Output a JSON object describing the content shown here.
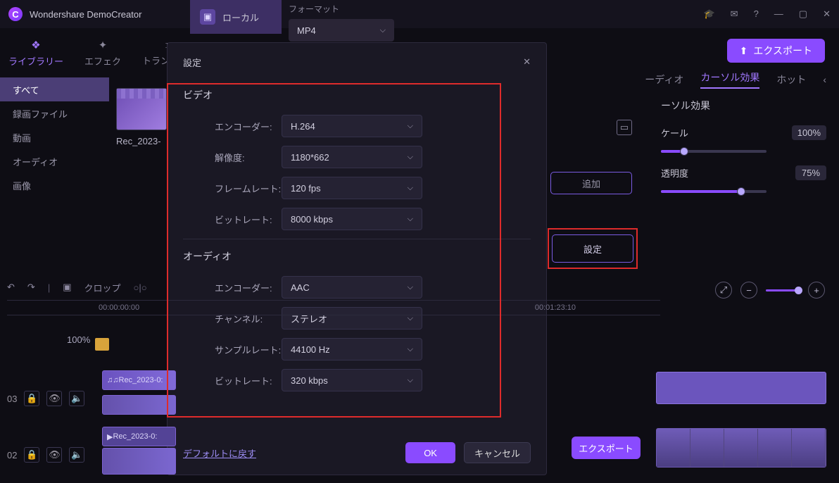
{
  "app": {
    "title": "Wondershare DemoCreator"
  },
  "win_icons": {
    "learn": "🎓",
    "mail": "✉",
    "help": "?",
    "min": "—",
    "max": "▢",
    "close": "✕"
  },
  "local_tab": {
    "label": "ローカル"
  },
  "format": {
    "label": "フォーマット",
    "value": "MP4"
  },
  "export_top": "エクスポート",
  "tabs": {
    "library": "ライブラリー",
    "effects": "エフェク",
    "transitions": "トランジショ"
  },
  "right_tabs": {
    "audio": "ーディオ",
    "cursor": "カーソル効果",
    "hot": "ホット",
    "caret": "‹"
  },
  "right_panel": {
    "title": "ーソル効果",
    "scale_label": "ケール",
    "scale_value": "100%",
    "opacity_label": "透明度",
    "opacity_value": "75%"
  },
  "sidebar": {
    "all": "すべて",
    "rec": "録画ファイル",
    "video": "動画",
    "audio": "オーディオ",
    "image": "画像"
  },
  "thumb_label": "Rec_2023-",
  "add_btn": "追加",
  "settings_btn": "設定",
  "dialog": {
    "title": "設定",
    "video": {
      "header": "ビデオ",
      "encoder_l": "エンコーダー:",
      "encoder_v": "H.264",
      "res_l": "解像度:",
      "res_v": "1180*662",
      "fps_l": "フレームレート:",
      "fps_v": "120 fps",
      "br_l": "ビットレート:",
      "br_v": "8000 kbps"
    },
    "audio": {
      "header": "オーディオ",
      "encoder_l": "エンコーダー:",
      "encoder_v": "AAC",
      "ch_l": "チャンネル:",
      "ch_v": "ステレオ",
      "sr_l": "サンプルレート:",
      "sr_v": "44100 Hz",
      "br_l": "ビットレート:",
      "br_v": "320 kbps"
    },
    "default_link": "デフォルトに戻す",
    "ok": "OK",
    "cancel": "キャンセル"
  },
  "export_bottom": "エクスポート",
  "timeline": {
    "toolbar_crop": "クロップ",
    "tc_left": "00:00:00:00",
    "tc_right": "00:01:23:10",
    "track3": {
      "num": "03",
      "clip_audio": "Rec_2023-0:"
    },
    "track2": {
      "num": "02",
      "clip_video": "Rec_2023-0:"
    },
    "pct": "100%"
  }
}
